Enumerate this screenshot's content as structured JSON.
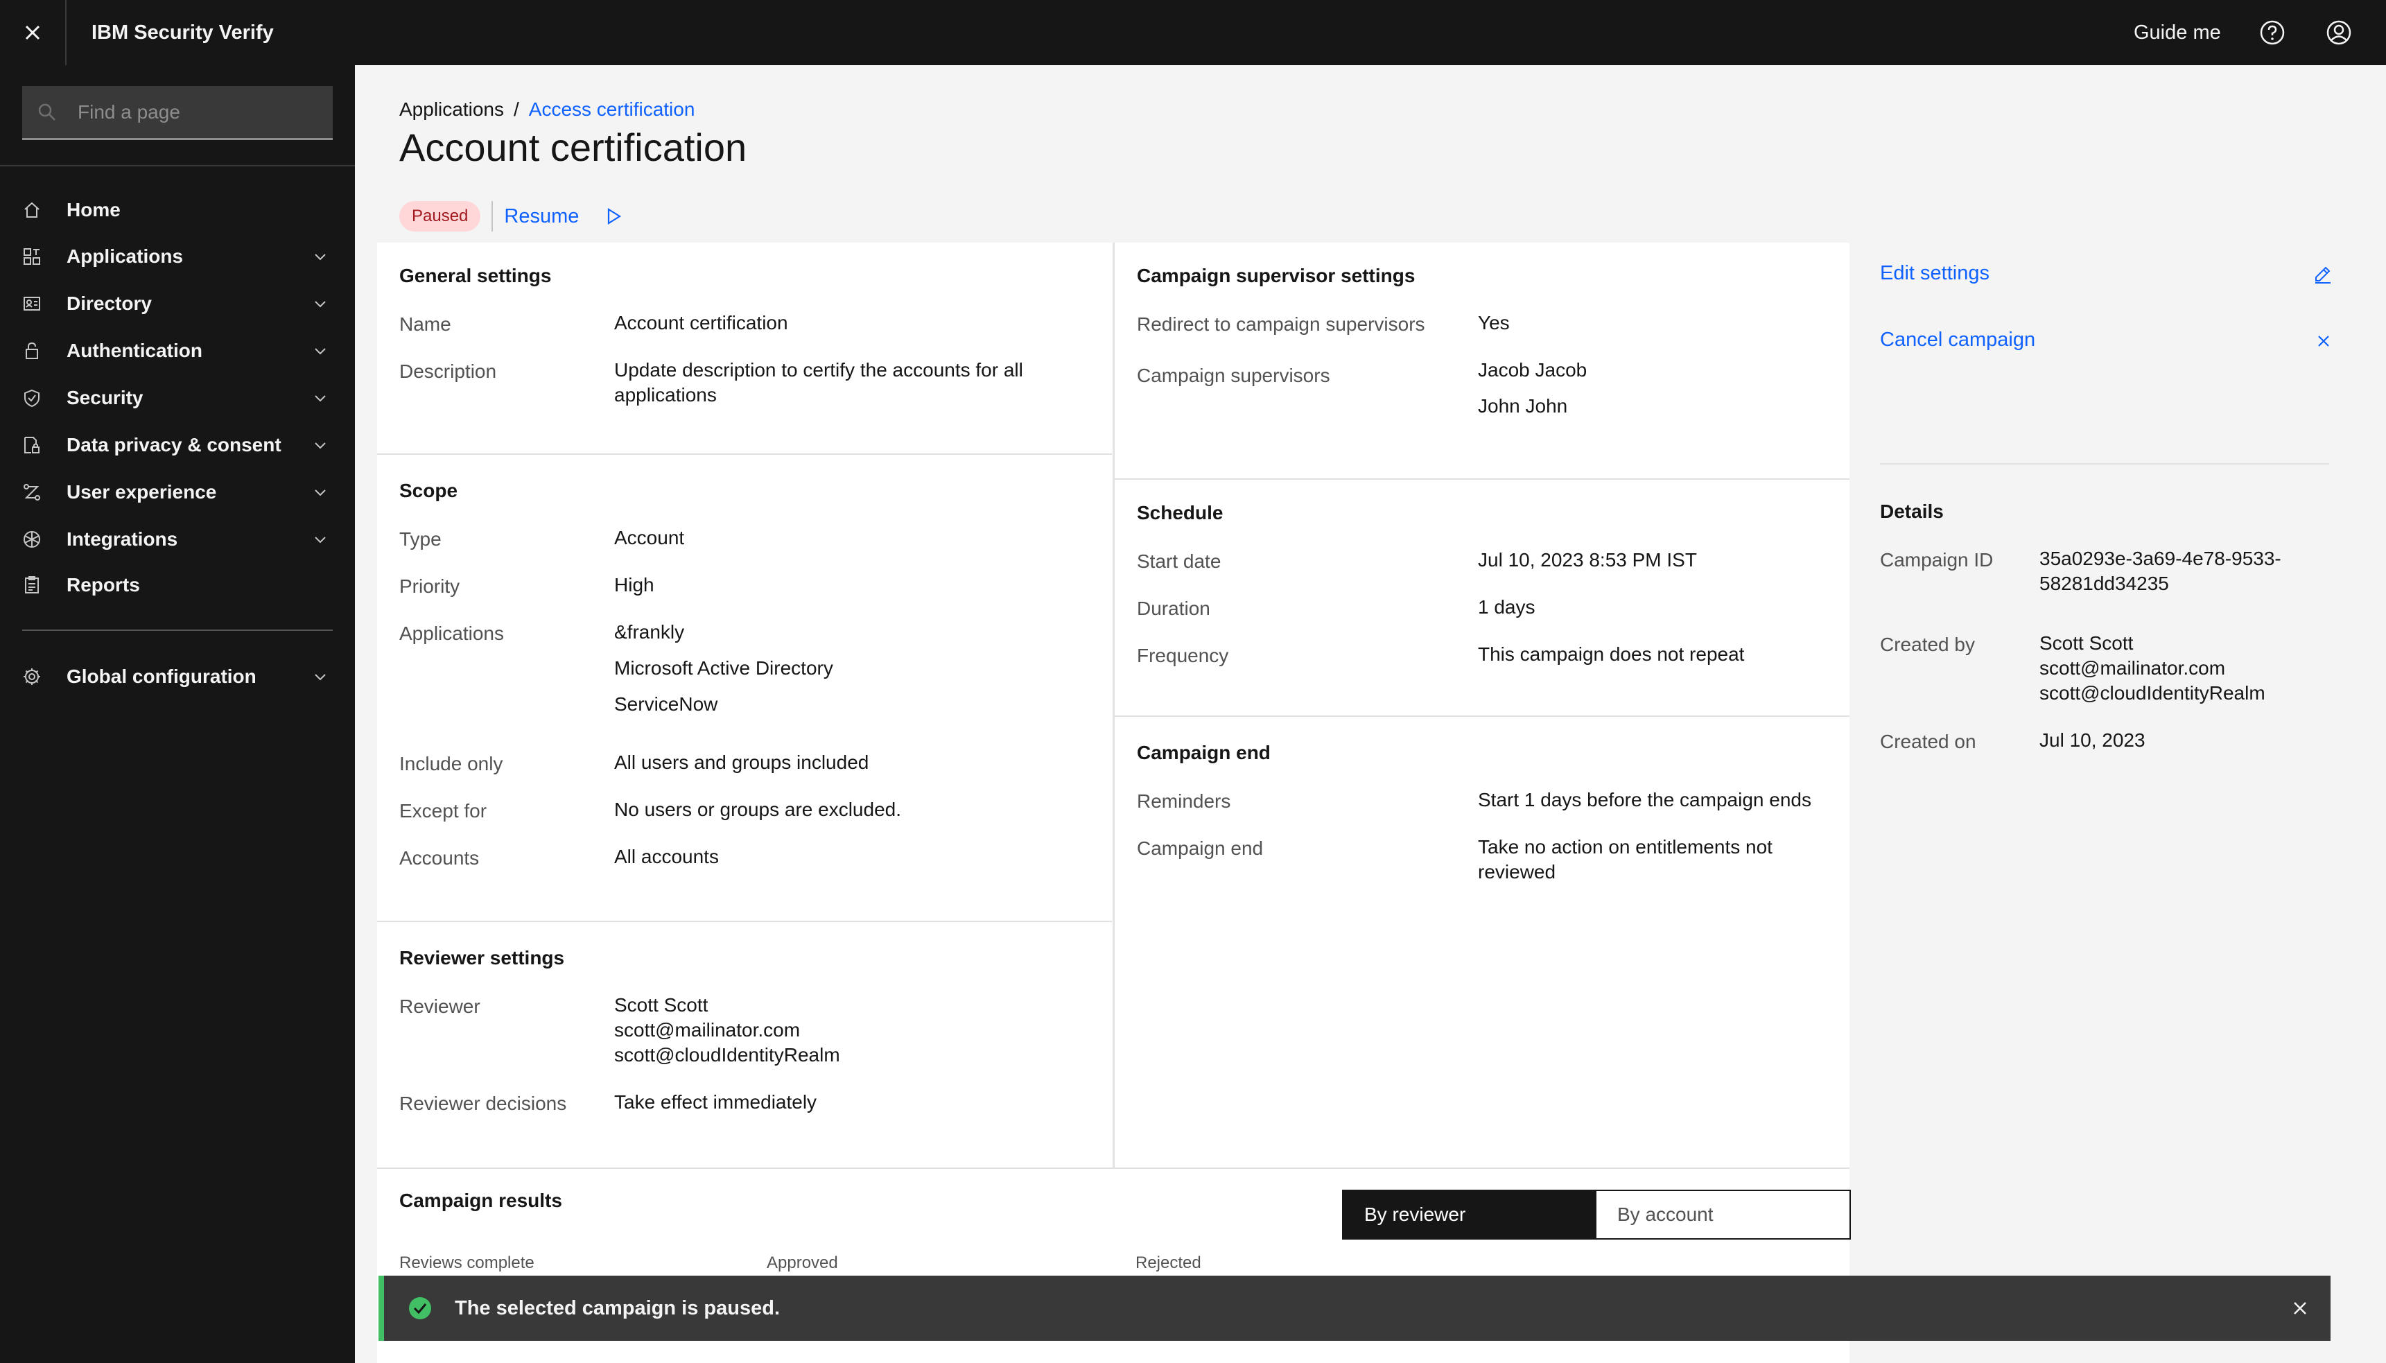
{
  "header": {
    "brand": "IBM Security Verify",
    "guide_label": "Guide me"
  },
  "sidebar": {
    "search_placeholder": "Find a page",
    "items": [
      {
        "label": "Home",
        "icon": "home-icon",
        "expandable": false
      },
      {
        "label": "Applications",
        "icon": "applications-icon",
        "expandable": true
      },
      {
        "label": "Directory",
        "icon": "directory-icon",
        "expandable": true
      },
      {
        "label": "Authentication",
        "icon": "lock-icon",
        "expandable": true
      },
      {
        "label": "Security",
        "icon": "shield-icon",
        "expandable": true
      },
      {
        "label": "Data privacy & consent",
        "icon": "data-privacy-icon",
        "expandable": true
      },
      {
        "label": "User experience",
        "icon": "user-experience-icon",
        "expandable": true
      },
      {
        "label": "Integrations",
        "icon": "integrations-icon",
        "expandable": true
      },
      {
        "label": "Reports",
        "icon": "reports-icon",
        "expandable": false
      },
      {
        "label": "Global configuration",
        "icon": "gear-icon",
        "expandable": true
      }
    ]
  },
  "breadcrumb": {
    "root": "Applications",
    "separator": "/",
    "current": "Access certification"
  },
  "page": {
    "title": "Account certification",
    "status": "Paused",
    "resume_label": "Resume"
  },
  "general": {
    "heading": "General settings",
    "name_label": "Name",
    "name_value": "Account certification",
    "description_label": "Description",
    "description_line1": "Update description to certify the accounts for all",
    "description_line2": "applications"
  },
  "scope": {
    "heading": "Scope",
    "type_label": "Type",
    "type_value": "Account",
    "priority_label": "Priority",
    "priority_value": "High",
    "applications_label": "Applications",
    "applications": [
      "&frankly",
      "Microsoft Active Directory",
      "ServiceNow"
    ],
    "include_label": "Include only",
    "include_value": "All users and groups included",
    "except_label": "Except for",
    "except_value": "No users or groups are excluded.",
    "accounts_label": "Accounts",
    "accounts_value": "All accounts"
  },
  "reviewer": {
    "heading": "Reviewer settings",
    "reviewer_label": "Reviewer",
    "reviewer_lines": [
      "Scott Scott",
      "scott@mailinator.com",
      "scott@cloudIdentityRealm"
    ],
    "decisions_label": "Reviewer decisions",
    "decisions_value": "Take effect immediately"
  },
  "supervisor": {
    "heading": "Campaign supervisor settings",
    "redirect_label": "Redirect to campaign supervisors",
    "redirect_value": "Yes",
    "supervisors_label": "Campaign supervisors",
    "supervisors": [
      "Jacob Jacob",
      "John John"
    ]
  },
  "schedule": {
    "heading": "Schedule",
    "start_label": "Start date",
    "start_value": "Jul 10, 2023 8:53 PM IST",
    "duration_label": "Duration",
    "duration_value": "1 days",
    "frequency_label": "Frequency",
    "frequency_value": "This campaign does not repeat"
  },
  "campaign_end": {
    "heading": "Campaign end",
    "reminders_label": "Reminders",
    "reminders_value": "Start 1 days before the campaign ends",
    "end_label": "Campaign end",
    "end_line1": "Take no action on entitlements not",
    "end_line2": "reviewed"
  },
  "actions": {
    "edit_label": "Edit settings",
    "cancel_label": "Cancel campaign"
  },
  "details": {
    "heading": "Details",
    "campaign_id_label": "Campaign ID",
    "campaign_id_line1": "35a0293e-3a69-4e78-9533-",
    "campaign_id_line2": "58281dd34235",
    "created_by_label": "Created by",
    "created_by_lines": [
      "Scott Scott",
      "scott@mailinator.com",
      "scott@cloudIdentityRealm"
    ],
    "created_on_label": "Created on",
    "created_on_value": "Jul 10, 2023"
  },
  "results": {
    "heading": "Campaign results",
    "by_reviewer": "By reviewer",
    "by_account": "By account",
    "col_reviews": "Reviews complete",
    "col_approved": "Approved",
    "col_rejected": "Rejected"
  },
  "toast": {
    "message": "The selected campaign is paused."
  },
  "colors": {
    "accent": "#0f62fe",
    "header_bg": "#161616",
    "success": "#42be65",
    "paused_tag_bg": "#ffd7d9",
    "paused_tag_text": "#a2191f"
  }
}
